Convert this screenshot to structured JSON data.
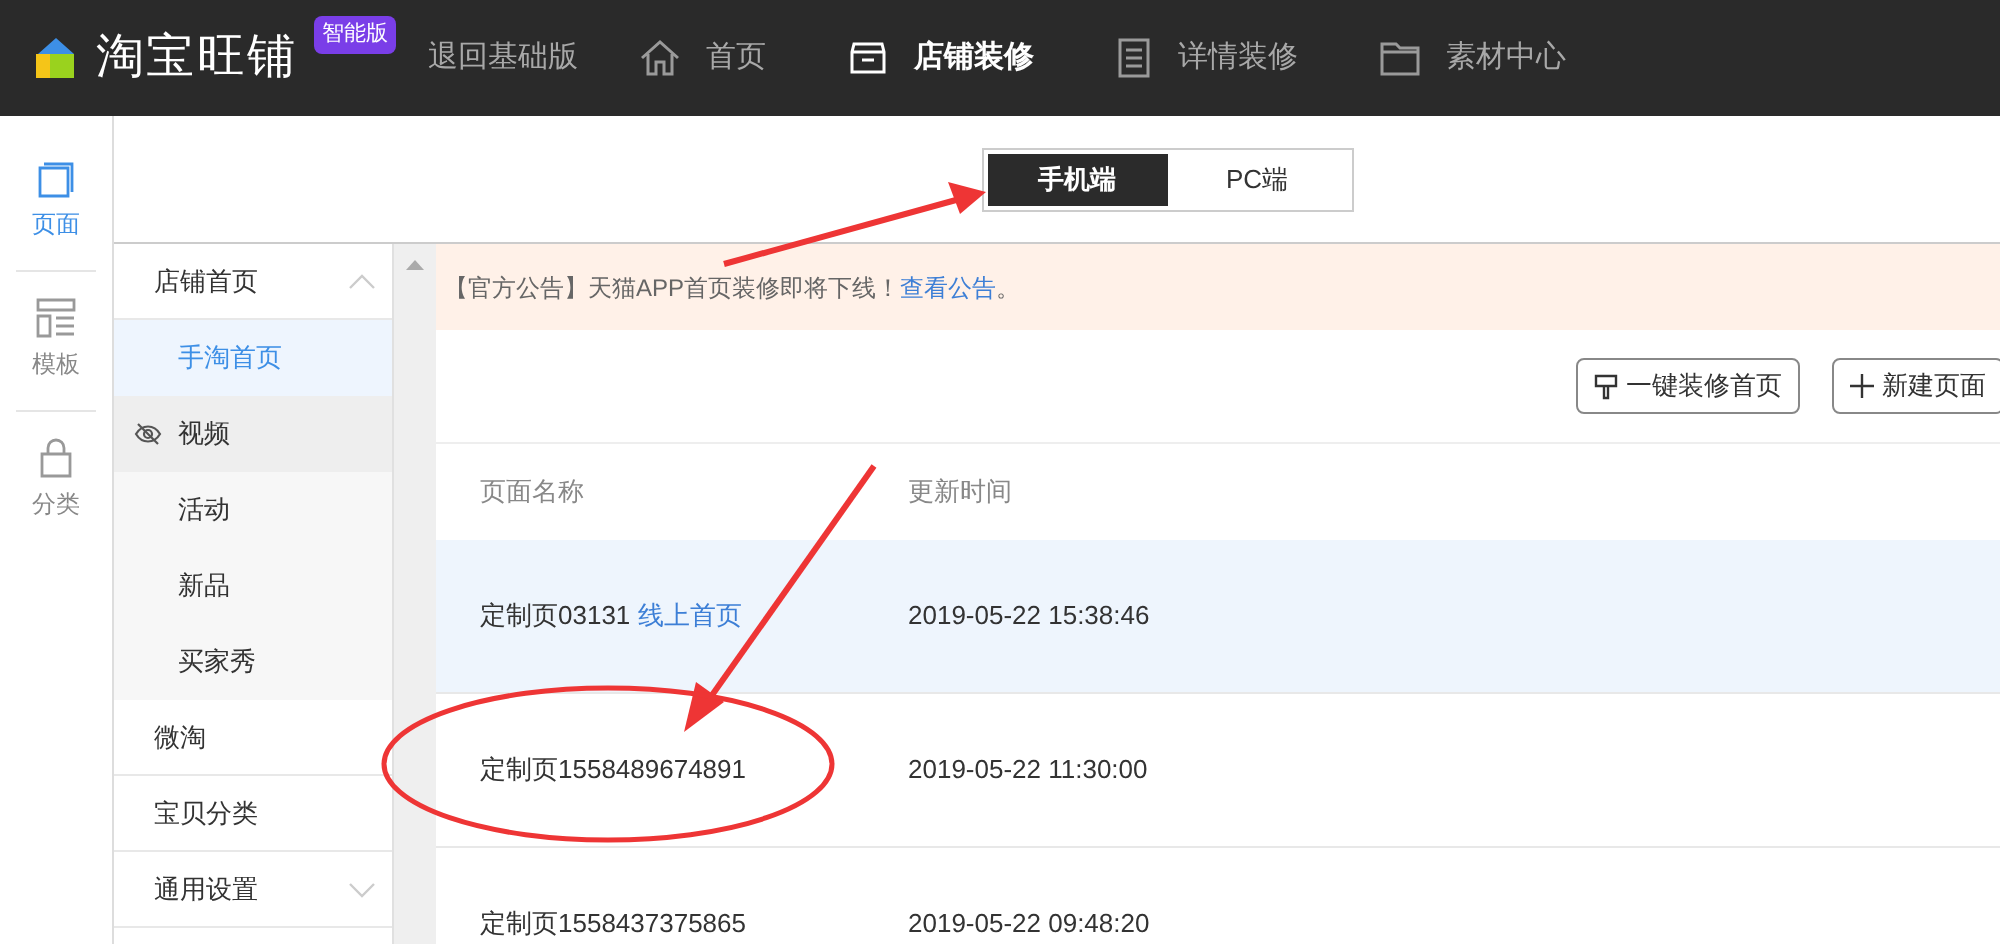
{
  "header": {
    "brand": "淘宝旺铺",
    "badge": "智能版",
    "back_link": "退回基础版",
    "nav": [
      {
        "label": "首页",
        "kind": "home",
        "selected": false
      },
      {
        "label": "店铺装修",
        "kind": "store",
        "selected": true
      },
      {
        "label": "详情装修",
        "kind": "doc",
        "selected": false
      },
      {
        "label": "素材中心",
        "kind": "folder",
        "selected": false
      }
    ]
  },
  "rail": [
    {
      "label": "页面",
      "kind": "page",
      "selected": true
    },
    {
      "label": "模板",
      "kind": "template",
      "selected": false
    },
    {
      "label": "分类",
      "kind": "bag",
      "selected": false
    }
  ],
  "sidebar": [
    {
      "label": "店铺首页",
      "expanded": true,
      "children": [
        {
          "label": "手淘首页",
          "selected": true,
          "hidden": false
        },
        {
          "label": "视频",
          "selected": false,
          "hidden": true
        },
        {
          "label": "活动",
          "selected": false,
          "hidden": false
        },
        {
          "label": "新品",
          "selected": false,
          "hidden": false
        },
        {
          "label": "买家秀",
          "selected": false,
          "hidden": false
        }
      ]
    },
    {
      "label": "微淘"
    },
    {
      "label": "宝贝分类"
    },
    {
      "label": "通用设置",
      "expanded": false
    }
  ],
  "device_tabs": [
    {
      "label": "手机端",
      "selected": true
    },
    {
      "label": "PC端",
      "selected": false
    }
  ],
  "notice": {
    "text": "【官方公告】天猫APP首页装修即将下线！",
    "link": "查看公告",
    "tail": "。"
  },
  "actions": [
    {
      "label": "一键装修首页",
      "kind": "brush"
    },
    {
      "label": "新建页面",
      "kind": "plus"
    }
  ],
  "table": {
    "columns": [
      "页面名称",
      "更新时间"
    ],
    "rows": [
      {
        "name": "定制页03131",
        "tag": "线上首页",
        "time": "2019-05-22 15:38:46",
        "selected": true
      },
      {
        "name": "定制页1558489674891",
        "time": "2019-05-22 11:30:00",
        "selected": false
      },
      {
        "name": "定制页1558437375865",
        "time": "2019-05-22 09:48:20",
        "selected": false
      }
    ]
  }
}
